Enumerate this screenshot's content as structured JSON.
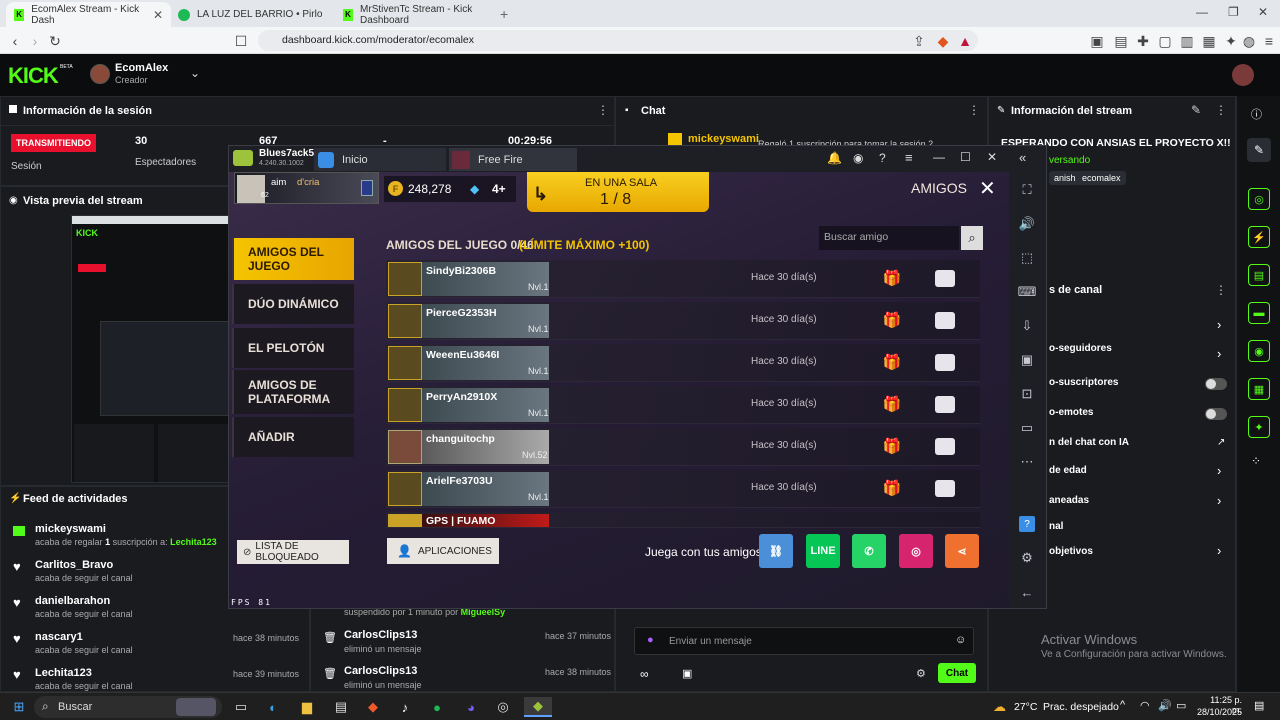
{
  "browser": {
    "tabs": [
      {
        "label": "EcomAlex Stream - Kick Dash",
        "active": true
      },
      {
        "label": "LA LUZ DEL BARRIO • Pirlo",
        "active": false
      },
      {
        "label": "MrStivenTc Stream - Kick Dashboard",
        "active": false
      }
    ],
    "url": "dashboard.kick.com/moderator/ecomalex"
  },
  "kick": {
    "logo": "KICK",
    "beta": "BETA",
    "user": "EcomAlex",
    "role": "Creador"
  },
  "session": {
    "title": "Información de la sesión",
    "status": "TRANSMITIENDO",
    "status_label": "Sesión",
    "followers_value": "30",
    "followers_label": "Espectadores",
    "viewers_value": "667",
    "other_value": "-",
    "duration": "00:29:56"
  },
  "preview": {
    "title": "Vista previa del stream"
  },
  "feed": {
    "title": "Feed de actividades",
    "items": [
      {
        "name": "mickeyswami",
        "text": "acaba de regalar",
        "count": "1",
        "text2": "suscripción a:",
        "target": "Lechita123",
        "time": ""
      },
      {
        "name": "Carlitos_Bravo",
        "text": "acaba de seguir el canal",
        "time": ""
      },
      {
        "name": "danielbarahon",
        "text": "acaba de seguir el canal",
        "time": ""
      },
      {
        "name": "nascary1",
        "text": "acaba de seguir el canal",
        "time": "hace 38 minutos"
      },
      {
        "name": "Lechita123",
        "text": "acaba de seguir el canal",
        "time": "hace 39 minutos"
      }
    ]
  },
  "chat": {
    "title": "Chat",
    "top_user": "mickeyswami",
    "top_text": "Regaló 1 suscripción para tomar la sesión 2",
    "mod_log": [
      {
        "text": "suspendido por 1 minuto por",
        "by": "MigueelSy"
      },
      {
        "name": "CarlosClips13",
        "text": "eliminó un mensaje",
        "time": "hace 37 minutos"
      },
      {
        "name": "CarlosClips13",
        "text": "eliminó un mensaje",
        "time": "hace 38 minutos"
      }
    ],
    "input_placeholder": "Enviar un mensaje",
    "send_label": "Chat"
  },
  "stream_info": {
    "title": "Información del stream",
    "stream_title": "ESPERANDO CON ANSIAS EL PROYECTO X!!",
    "category": "versando",
    "tags": [
      "anish",
      "ecomalex"
    ],
    "section_title": "s de canal",
    "rows": [
      {
        "label": "o-seguidores",
        "type": "arrow"
      },
      {
        "label": "o-suscriptores",
        "type": "toggle"
      },
      {
        "label": "o-emotes",
        "type": "toggle"
      },
      {
        "label": "n del chat con IA",
        "type": "link"
      },
      {
        "label": "de edad",
        "type": "arrow"
      },
      {
        "label": "aneadas",
        "type": "arrow"
      },
      {
        "label": "nal",
        "type": "none"
      },
      {
        "label": "objetivos",
        "type": "arrow"
      }
    ]
  },
  "emulator": {
    "player": "Blues7ack5",
    "version": "4.240.30.1002",
    "tabs": [
      "Inicio",
      "Free Fire"
    ],
    "fps_label": "FPS  81"
  },
  "game": {
    "profile_name": "aim",
    "profile_tag": "d'cria",
    "profile_level": "62",
    "gold": "248,278",
    "diamonds": "4+",
    "room_label": "EN UNA SALA",
    "room_count": "1 / 8",
    "header": "AMIGOS",
    "search_placeholder": "Buscar amigo",
    "list_title": "AMIGOS DEL JUEGO 0/46",
    "list_limit": "(LÍMITE MÁXIMO +100)",
    "menu": [
      "AMIGOS DEL JUEGO",
      "DÚO DINÁMICO",
      "EL PELOTÓN",
      "AMIGOS DE PLATAFORMA",
      "AÑADIR"
    ],
    "friends": [
      {
        "name": "SindyBi2306B",
        "level": "Nvl.1",
        "last": "Hace 30 día(s)"
      },
      {
        "name": "PierceG2353H",
        "level": "Nvl.1",
        "last": "Hace 30 día(s)"
      },
      {
        "name": "WeeenEu3646I",
        "level": "Nvl.1",
        "last": "Hace 30 día(s)"
      },
      {
        "name": "PerryAn2910X",
        "level": "Nvl.1",
        "last": "Hace 30 día(s)"
      },
      {
        "name": "changuitochp",
        "level": "Nvl.52",
        "last": "Hace 30 día(s)"
      },
      {
        "name": "ArielFe3703U",
        "level": "Nvl.1",
        "last": "Hace 30 día(s)"
      },
      {
        "name": "GPS | FUAMO",
        "level": "",
        "last": ""
      }
    ],
    "blocked_label": "LISTA DE BLOQUEADO",
    "apps_label": "APLICACIONES",
    "play_label": "Juega con tus amigos",
    "social": [
      {
        "name": "link",
        "color": "#4a8fd8"
      },
      {
        "name": "LINE",
        "color": "#06c755"
      },
      {
        "name": "whatsapp",
        "color": "#25d366"
      },
      {
        "name": "instagram",
        "color": "#d6246e"
      },
      {
        "name": "share",
        "color": "#f07030"
      }
    ]
  },
  "windows_activation": {
    "title": "Activar Windows",
    "text": "Ve a Configuración para activar Windows."
  },
  "taskbar": {
    "search": "Buscar",
    "temp": "27°C",
    "weather": "Prac. despejado",
    "time": "11:25 p. m.",
    "date": "28/10/2025"
  },
  "colors": {
    "kick_green": "#53fc18",
    "live_red": "#e8102c",
    "game_yellow": "#f5c400"
  }
}
